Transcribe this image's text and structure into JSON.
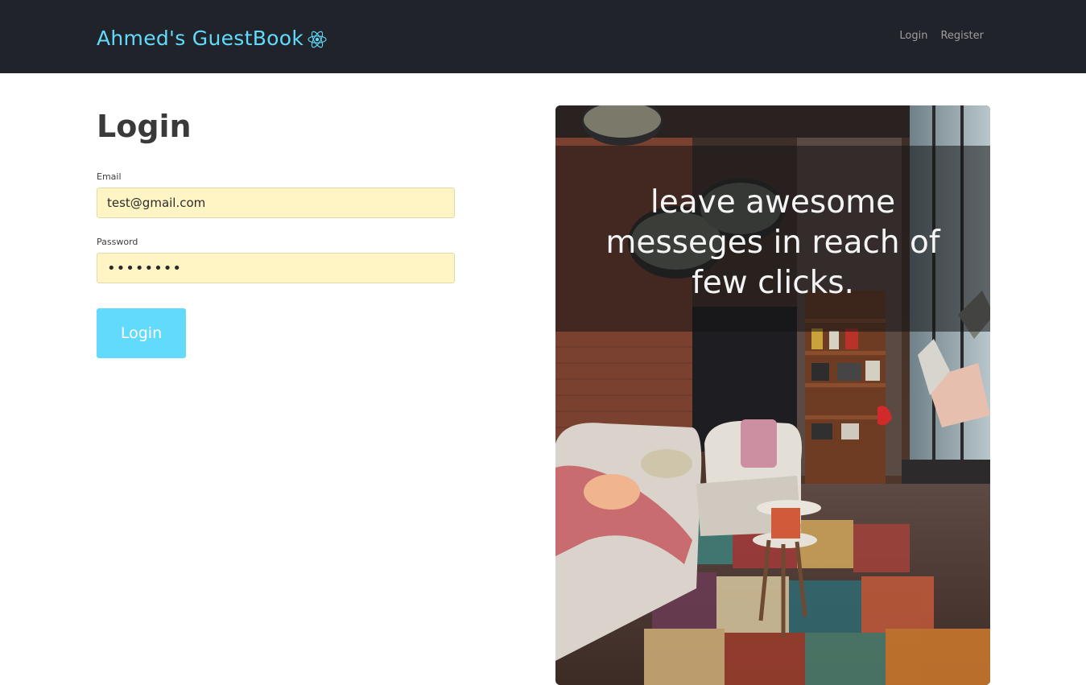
{
  "navbar": {
    "brand_title": "Ahmed's GuestBook",
    "brand_icon": "react-atom-icon",
    "brand_color": "#61dafb",
    "links": [
      {
        "label": "Login"
      },
      {
        "label": "Register"
      }
    ]
  },
  "login": {
    "heading": "Login",
    "email_label": "Email",
    "email_value": "test@gmail.com",
    "password_label": "Password",
    "password_value": "••••••••",
    "submit_label": "Login"
  },
  "hero": {
    "tagline": "leave awesome messeges in reach of few clicks."
  },
  "colors": {
    "navbar_bg": "#20232a",
    "accent": "#61dafb",
    "autofill_bg": "#fff5c4"
  }
}
